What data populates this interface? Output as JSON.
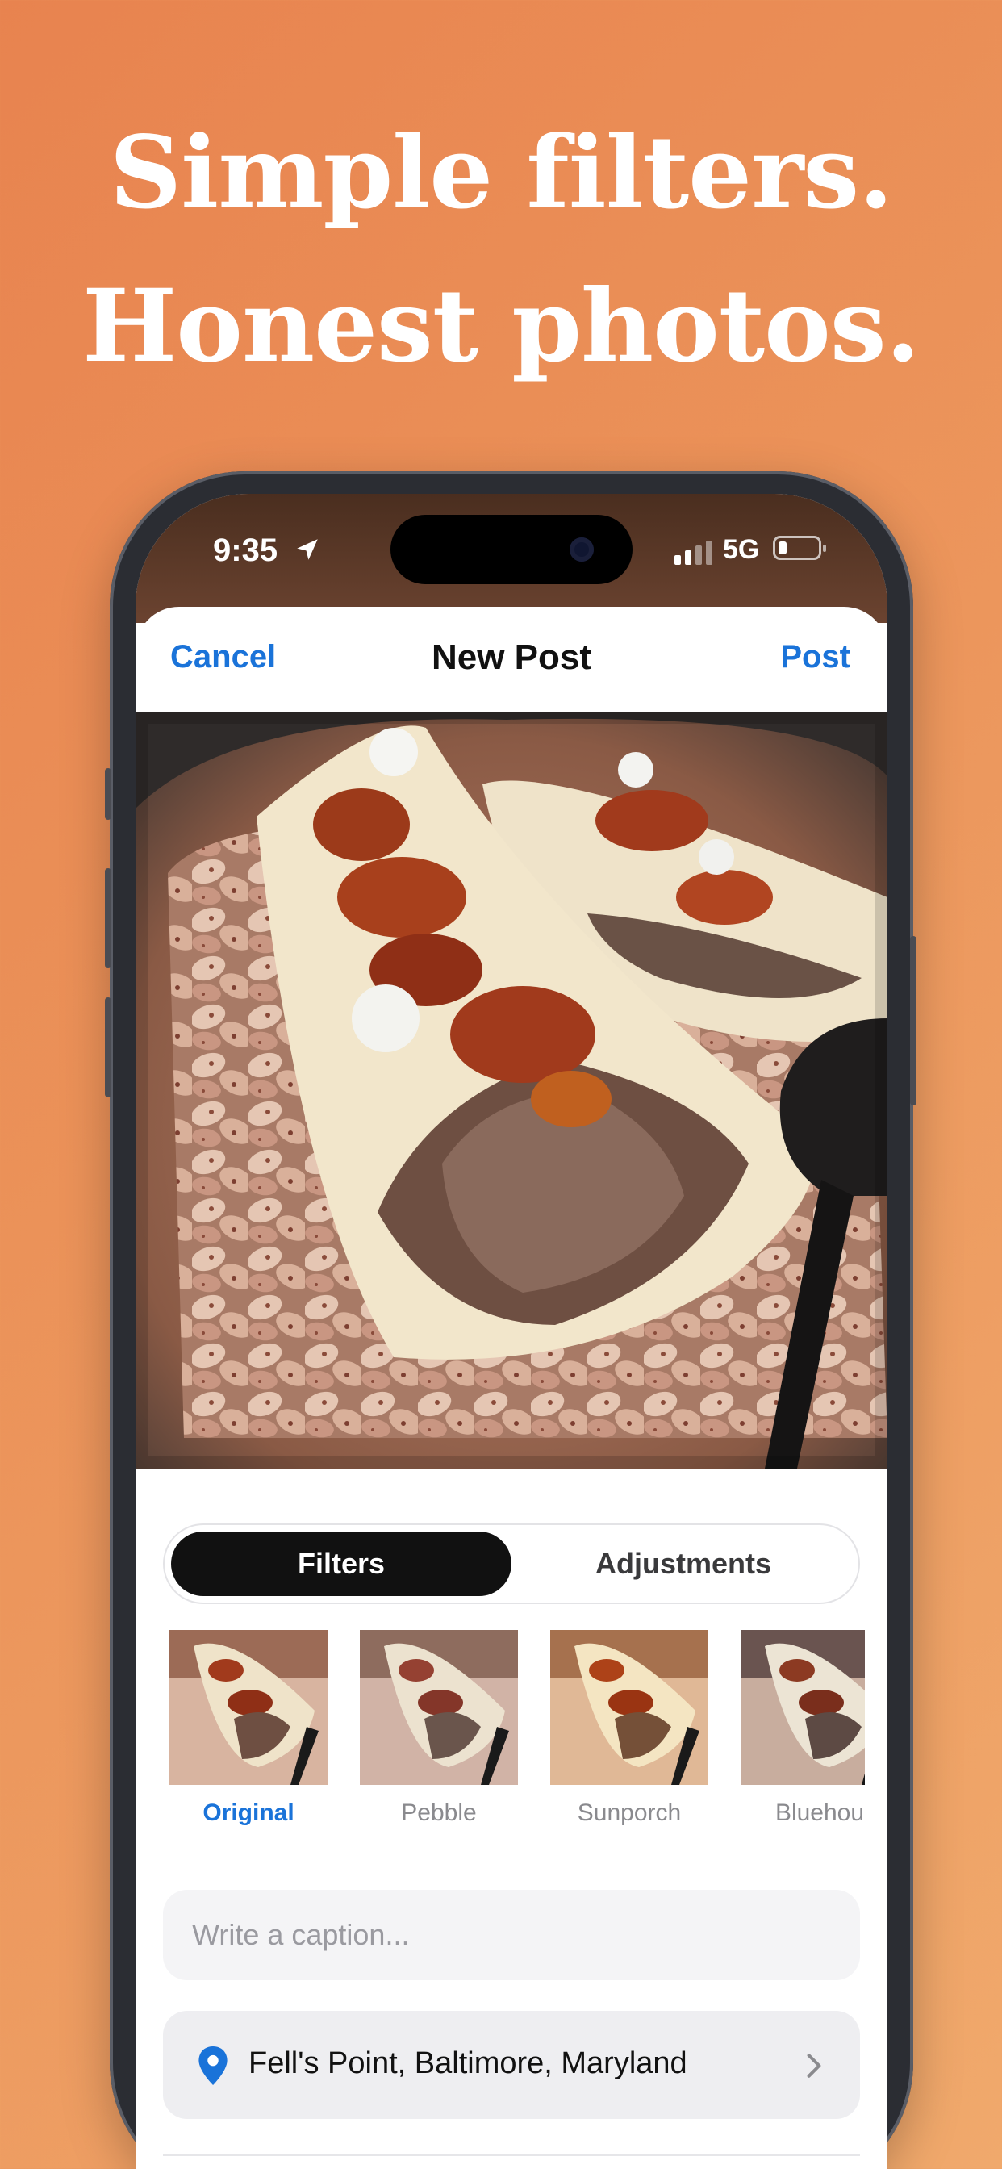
{
  "headline": {
    "line1": "Simple filters.",
    "line2": "Honest photos."
  },
  "status_bar": {
    "time": "9:35",
    "network": "5G",
    "signal_bars": 2,
    "battery_level": 0.15
  },
  "nav": {
    "cancel_label": "Cancel",
    "title": "New Post",
    "post_label": "Post"
  },
  "photo": {
    "subject": "roasted bone marrow with tomato jam on beans"
  },
  "segmented_control": {
    "selected": "Filters",
    "options": [
      "Filters",
      "Adjustments"
    ]
  },
  "filters": [
    {
      "label": "Original",
      "selected": true
    },
    {
      "label": "Pebble",
      "selected": false
    },
    {
      "label": "Sunporch",
      "selected": false
    },
    {
      "label": "Bluehou",
      "selected": false
    }
  ],
  "caption": {
    "placeholder": "Write a caption..."
  },
  "location": {
    "icon": "map-pin-icon",
    "text": "Fell's Point, Baltimore, Maryland"
  },
  "colors": {
    "background_start": "#e8834f",
    "background_end": "#f0a96c",
    "accent": "#1a73d9",
    "segment_active": "#111111"
  }
}
